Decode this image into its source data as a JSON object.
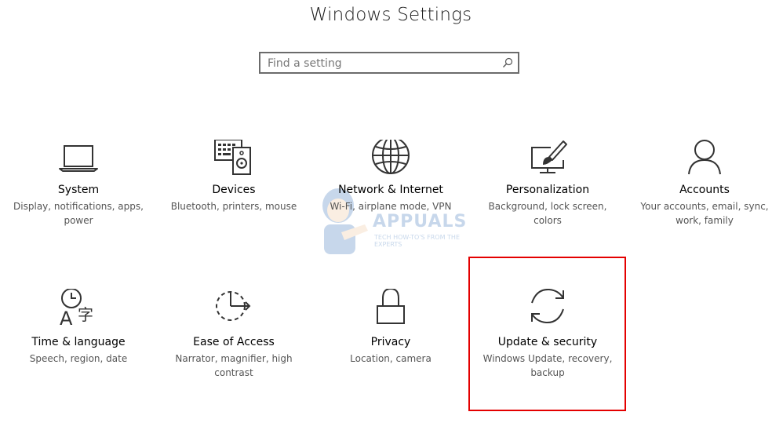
{
  "window": {
    "title": "Windows Settings"
  },
  "search": {
    "placeholder": "Find a setting",
    "value": ""
  },
  "tiles": [
    {
      "name": "System",
      "desc": "Display, notifications, apps, power",
      "icon": "laptop-icon"
    },
    {
      "name": "Devices",
      "desc": "Bluetooth, printers, mouse",
      "icon": "devices-icon"
    },
    {
      "name": "Network & Internet",
      "desc": "Wi-Fi, airplane mode, VPN",
      "icon": "globe-icon"
    },
    {
      "name": "Personalization",
      "desc": "Background, lock screen, colors",
      "icon": "paintbrush-monitor-icon"
    },
    {
      "name": "Accounts",
      "desc": "Your accounts, email, sync, work, family",
      "icon": "person-icon"
    },
    {
      "name": "Time & language",
      "desc": "Speech, region, date",
      "icon": "time-language-icon"
    },
    {
      "name": "Ease of Access",
      "desc": "Narrator, magnifier, high contrast",
      "icon": "ease-of-access-icon"
    },
    {
      "name": "Privacy",
      "desc": "Location, camera",
      "icon": "lock-icon"
    },
    {
      "name": "Update & security",
      "desc": "Windows Update, recovery, backup",
      "icon": "sync-arrows-icon"
    }
  ],
  "watermark": {
    "brand": "APPUALS",
    "tagline": "TECH HOW-TO'S FROM THE EXPERTS"
  },
  "colors": {
    "highlight": "#e40000",
    "icon_stroke": "#333333",
    "desc_text": "#555555"
  }
}
